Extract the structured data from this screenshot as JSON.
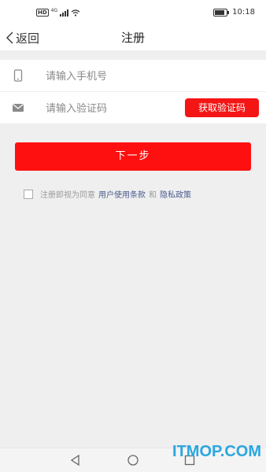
{
  "statusbar": {
    "hd": "HD",
    "network": "4G",
    "time": "10:18",
    "battery_level": 0.85
  },
  "header": {
    "back_label": "返回",
    "title": "注册"
  },
  "form": {
    "phone_placeholder": "请输入手机号",
    "code_placeholder": "请输入验证码",
    "get_code_label": "获取验证码"
  },
  "next_label": "下一步",
  "agreement": {
    "prefix": "注册即视为同意",
    "terms": "用户使用条款",
    "and": "和",
    "privacy": "隐私政策"
  },
  "watermark": "ITMOP.COM",
  "colors": {
    "primary": "#ff1010",
    "link": "#4b5d8f"
  }
}
